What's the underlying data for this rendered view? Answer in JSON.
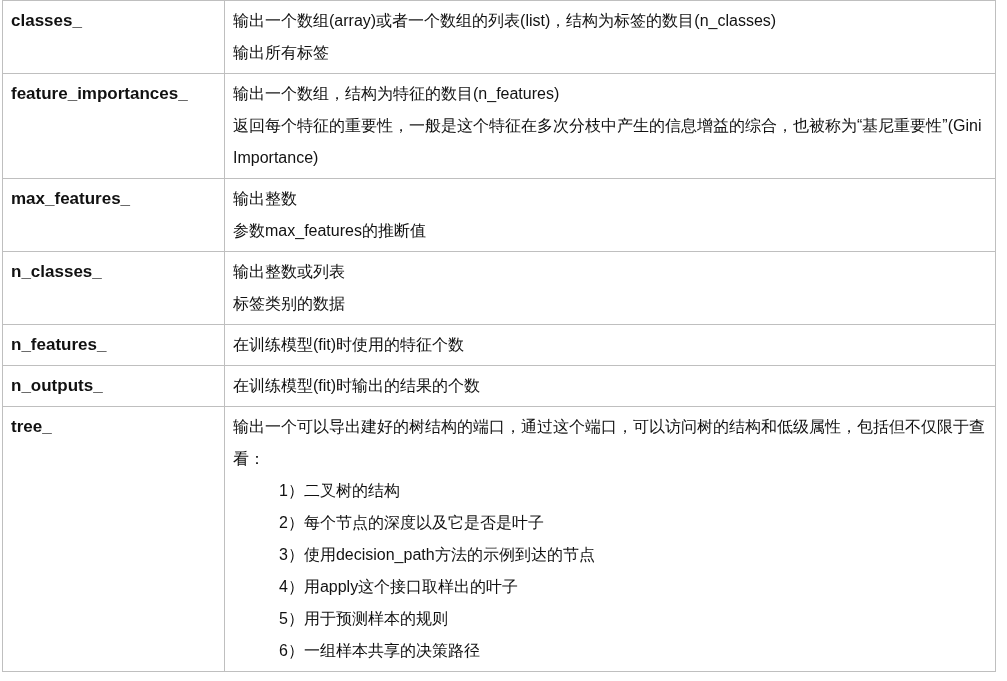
{
  "table": {
    "rows": [
      {
        "attribute": "classes_",
        "lines": [
          "输出一个数组(array)或者一个数组的列表(list)，结构为标签的数目(n_classes)",
          "输出所有标签"
        ]
      },
      {
        "attribute": "feature_importances_",
        "lines": [
          "输出一个数组，结构为特征的数目(n_features)",
          "返回每个特征的重要性，一般是这个特征在多次分枝中产生的信息增益的综合，也被称为“基尼重要性”(Gini Importance)"
        ]
      },
      {
        "attribute": "max_features_",
        "lines": [
          "输出整数",
          "参数max_features的推断值"
        ]
      },
      {
        "attribute": "n_classes_",
        "lines": [
          "输出整数或列表",
          "标签类别的数据"
        ]
      },
      {
        "attribute": "n_features_",
        "lines": [
          "在训练模型(fit)时使用的特征个数"
        ]
      },
      {
        "attribute": "n_outputs_",
        "lines": [
          "在训练模型(fit)时输出的结果的个数"
        ]
      },
      {
        "attribute": "tree_",
        "lines": [
          "输出一个可以导出建好的树结构的端口，通过这个端口，可以访问树的结构和低级属性，包括但不仅限于查看："
        ],
        "items": [
          "1）二叉树的结构",
          "2）每个节点的深度以及它是否是叶子",
          "3）使用decision_path方法的示例到达的节点",
          "4）用apply这个接口取样出的叶子",
          "5）用于预测样本的规则",
          "6）一组样本共享的决策路径"
        ]
      }
    ]
  }
}
